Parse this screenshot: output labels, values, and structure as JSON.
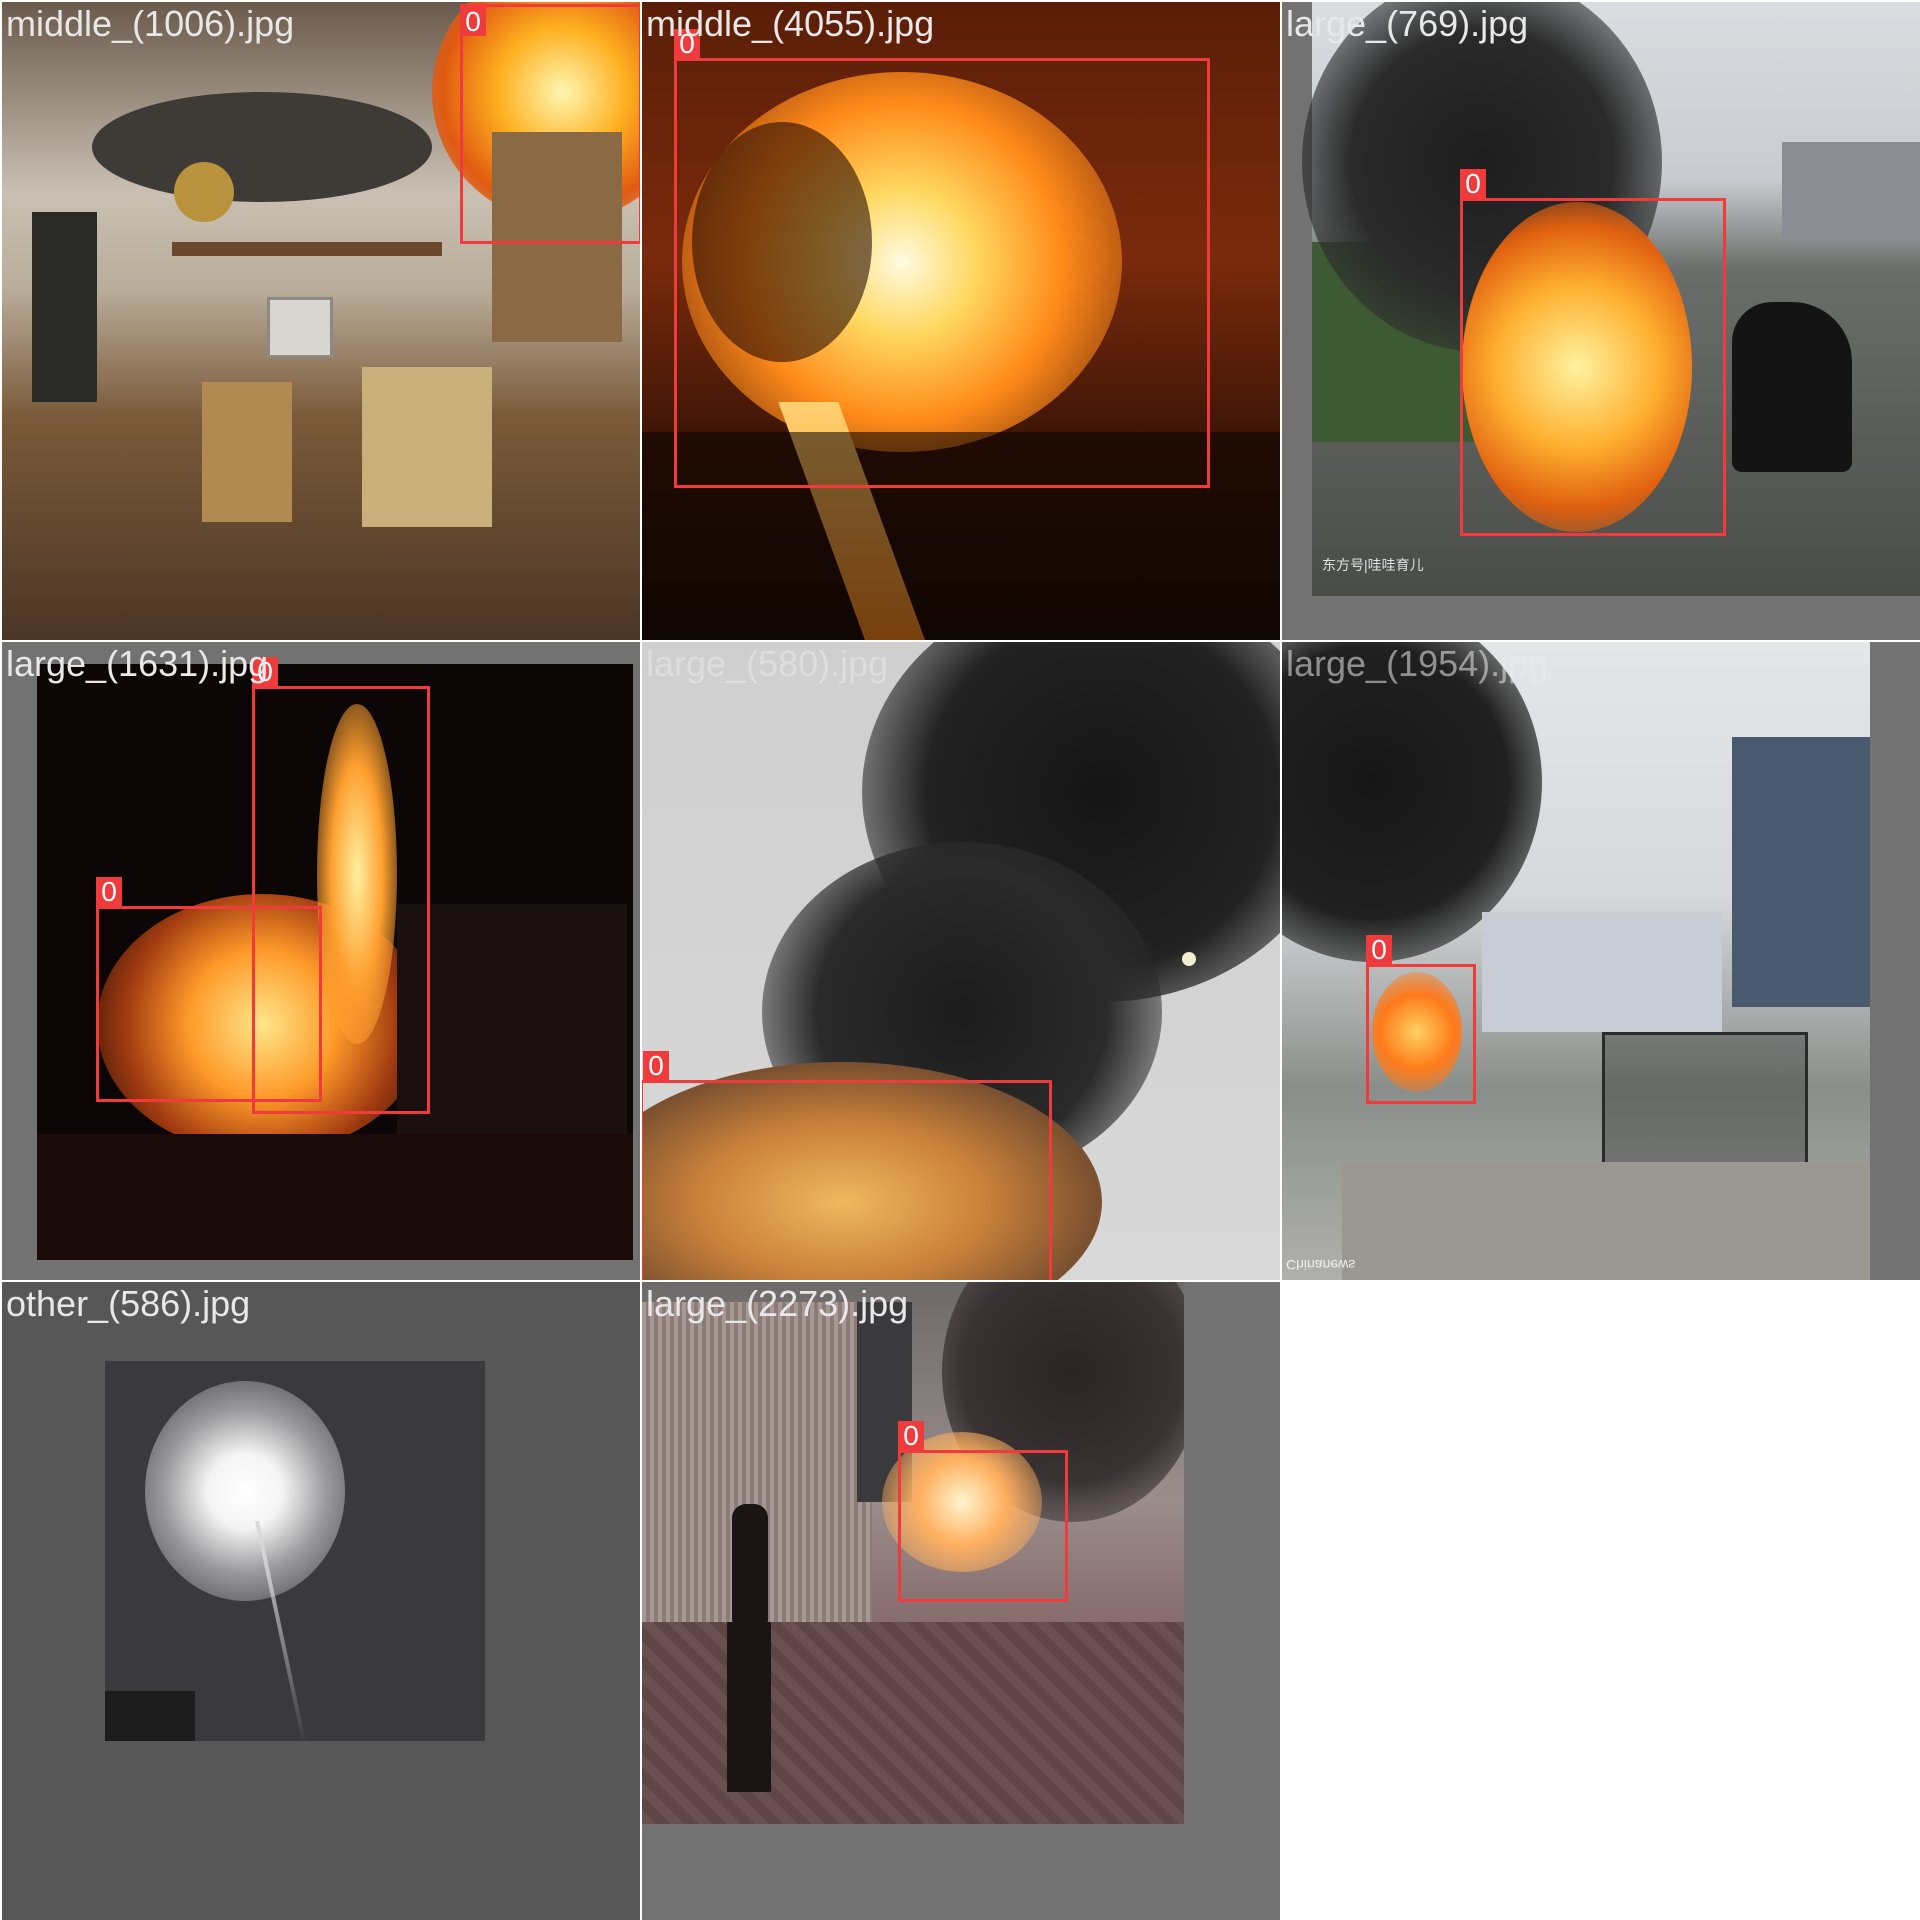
{
  "detections": [
    {
      "filename": "middle_(1006).jpg",
      "boxes": [
        {
          "label": "0"
        }
      ]
    },
    {
      "filename": "middle_(4055).jpg",
      "boxes": [
        {
          "label": "0"
        }
      ]
    },
    {
      "filename": "large_(769).jpg",
      "boxes": [
        {
          "label": "0"
        }
      ],
      "watermark": "东方号|哇哇育儿"
    },
    {
      "filename": "large_(1631).jpg",
      "boxes": [
        {
          "label": "0"
        },
        {
          "label": "0"
        }
      ]
    },
    {
      "filename": "large_(580).jpg",
      "boxes": [
        {
          "label": "0"
        }
      ]
    },
    {
      "filename": "large_(1954).jpg",
      "boxes": [
        {
          "label": "0"
        }
      ],
      "watermark": "Chinanews"
    },
    {
      "filename": "other_(586).jpg",
      "boxes": []
    },
    {
      "filename": "large_(2273).jpg",
      "boxes": [
        {
          "label": "0"
        }
      ]
    }
  ],
  "colors": {
    "box": "#ef3b3b",
    "padding": "#727272"
  }
}
